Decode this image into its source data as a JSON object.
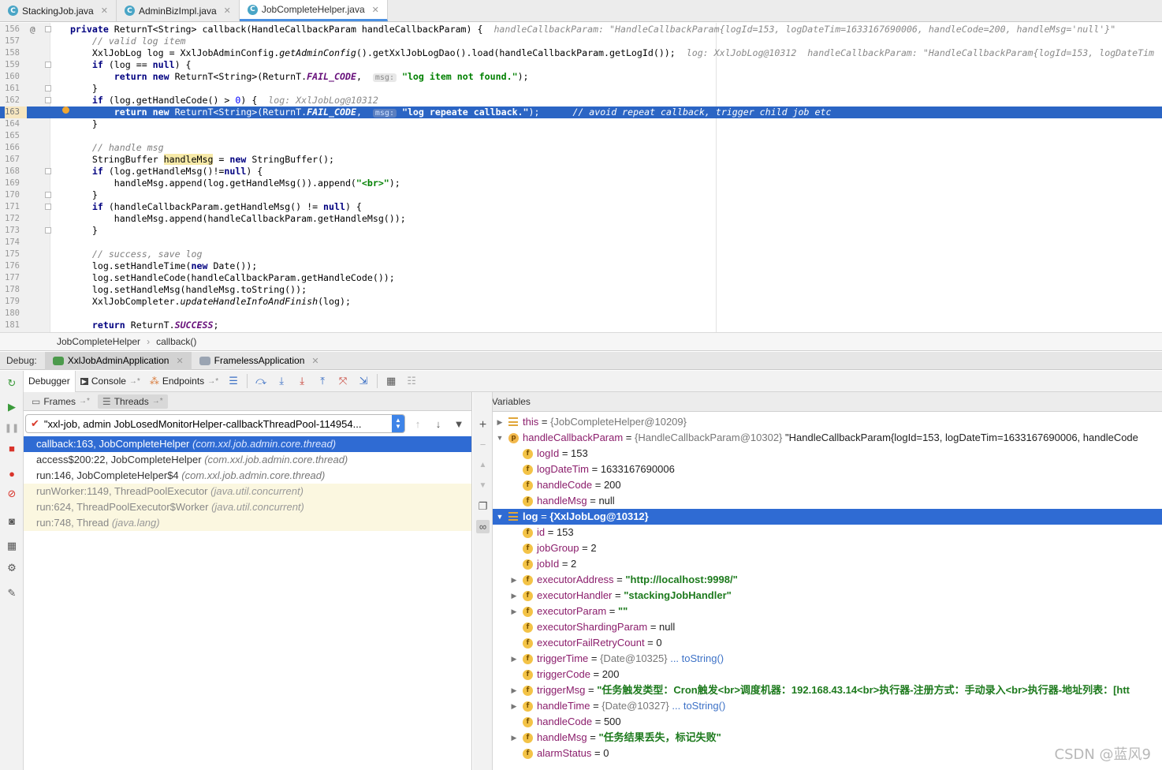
{
  "tabs": [
    {
      "label": "StackingJob.java",
      "active": false
    },
    {
      "label": "AdminBizImpl.java",
      "active": false
    },
    {
      "label": "JobCompleteHelper.java",
      "active": true
    }
  ],
  "editor": {
    "lines": [
      {
        "n": "156",
        "html": "<span class=\"kw\">private</span> ReturnT&lt;String&gt; callback(HandleCallbackParam handleCallbackParam) {  <span class=\"inl\">handleCallbackParam: \"HandleCallbackParam{logId=153, logDateTim=1633167690006, handleCode=200, handleMsg='null'}\"</span>"
      },
      {
        "n": "157",
        "html": "    <span class=\"cm\">// valid log item</span>"
      },
      {
        "n": "158",
        "html": "    XxlJobLog log = XxlJobAdminConfig.<span class=\"it\">getAdminConfig</span>().getXxlJobLogDao().load(handleCallbackParam.getLogId());  <span class=\"inl\">log: XxlJobLog@10312  handleCallbackParam: \"HandleCallbackParam{logId=153, logDateTim</span>"
      },
      {
        "n": "159",
        "html": "    <span class=\"kw\">if</span> (log == <span class=\"kw\">null</span>) {"
      },
      {
        "n": "160",
        "html": "        <span class=\"kw\">return new</span> ReturnT&lt;String&gt;(ReturnT.<span class=\"cst\">FAIL_CODE</span>,  <span class=\"hintbox\">msg:</span> <span class=\"st\">\"log item not found.\"</span>);"
      },
      {
        "n": "161",
        "html": "    }"
      },
      {
        "n": "162",
        "html": "    <span class=\"kw\">if</span> (log.getHandleCode() &gt; <span style=\"color:#0000ff\">0</span>) {  <span class=\"inl\">log: XxlJobLog@10312</span>"
      },
      {
        "n": "163",
        "html": "        <span class=\"kw\">return new</span> ReturnT&lt;String&gt;(ReturnT.<span class=\"cst\">FAIL_CODE</span>,  <span class=\"hintbox\">msg:</span> <span class=\"st\">\"log repeate callback.\"</span>);      <span class=\"cm\">// avoid repeat callback, trigger child job etc</span>"
      },
      {
        "n": "164",
        "html": "    }"
      },
      {
        "n": "165",
        "html": ""
      },
      {
        "n": "166",
        "html": "    <span class=\"cm\">// handle msg</span>"
      },
      {
        "n": "167",
        "html": "    StringBuffer <span class=\"var-hl\">handleMsg</span> = <span class=\"kw\">new</span> StringBuffer();"
      },
      {
        "n": "168",
        "html": "    <span class=\"kw\">if</span> (log.getHandleMsg()!=<span class=\"kw\">null</span>) {"
      },
      {
        "n": "169",
        "html": "        handleMsg.append(log.getHandleMsg()).append(<span class=\"st\">\"&lt;br&gt;\"</span>);"
      },
      {
        "n": "170",
        "html": "    }"
      },
      {
        "n": "171",
        "html": "    <span class=\"kw\">if</span> (handleCallbackParam.getHandleMsg() != <span class=\"kw\">null</span>) {"
      },
      {
        "n": "172",
        "html": "        handleMsg.append(handleCallbackParam.getHandleMsg());"
      },
      {
        "n": "173",
        "html": "    }"
      },
      {
        "n": "174",
        "html": ""
      },
      {
        "n": "175",
        "html": "    <span class=\"cm\">// success, save log</span>"
      },
      {
        "n": "176",
        "html": "    log.setHandleTime(<span class=\"kw\">new</span> Date());"
      },
      {
        "n": "177",
        "html": "    log.setHandleCode(handleCallbackParam.getHandleCode());"
      },
      {
        "n": "178",
        "html": "    log.setHandleMsg(handleMsg.toString());"
      },
      {
        "n": "179",
        "html": "    XxlJobCompleter.<span class=\"it\">updateHandleInfoAndFinish</span>(log);"
      },
      {
        "n": "180",
        "html": ""
      },
      {
        "n": "181",
        "html": "    <span class=\"kw\">return</span> ReturnT.<span class=\"cst\">SUCCESS</span>;"
      }
    ],
    "current_line": "163"
  },
  "breadcrumb": [
    "JobCompleteHelper",
    "callback()"
  ],
  "debug": {
    "label": "Debug:",
    "sessions": [
      {
        "label": "XxlJobAdminApplication",
        "active": true
      },
      {
        "label": "FramelessApplication",
        "active": false
      }
    ],
    "toolbar_tabs": [
      {
        "label": "Debugger",
        "active": true
      },
      {
        "label": "Console",
        "active": false
      },
      {
        "label": "Endpoints",
        "active": false
      }
    ]
  },
  "frames": {
    "tab_frames": "Frames",
    "tab_threads": "Threads",
    "thread": "\"xxl-job, admin JobLosedMonitorHelper-callbackThreadPool-114954...",
    "items": [
      {
        "method": "callback:163, JobCompleteHelper",
        "pkg": "(com.xxl.job.admin.core.thread)",
        "kind": "selected"
      },
      {
        "method": "access$200:22, JobCompleteHelper",
        "pkg": "(com.xxl.job.admin.core.thread)",
        "kind": "normal"
      },
      {
        "method": "run:146, JobCompleteHelper$4",
        "pkg": "(com.xxl.job.admin.core.thread)",
        "kind": "normal"
      },
      {
        "method": "runWorker:1149, ThreadPoolExecutor",
        "pkg": "(java.util.concurrent)",
        "kind": "lib"
      },
      {
        "method": "run:624, ThreadPoolExecutor$Worker",
        "pkg": "(java.util.concurrent)",
        "kind": "lib"
      },
      {
        "method": "run:748, Thread",
        "pkg": "(java.lang)",
        "kind": "lib"
      }
    ]
  },
  "variables": {
    "title": "Variables",
    "rows": [
      {
        "depth": 0,
        "expand": "closed",
        "icon": "list",
        "name": "this",
        "eq": " = ",
        "val": "{JobCompleteHelper@10209}",
        "vt": "ref"
      },
      {
        "depth": 0,
        "expand": "open",
        "icon": "p",
        "name": "handleCallbackParam",
        "eq": " = ",
        "val": "{HandleCallbackParam@10302} \"HandleCallbackParam{logId=153, logDateTim=1633167690006, handleCode",
        "vt": "mixed"
      },
      {
        "depth": 1,
        "expand": "none",
        "icon": "f",
        "name": "logId",
        "eq": " = ",
        "val": "153",
        "vt": "plain"
      },
      {
        "depth": 1,
        "expand": "none",
        "icon": "f",
        "name": "logDateTim",
        "eq": " = ",
        "val": "1633167690006",
        "vt": "plain"
      },
      {
        "depth": 1,
        "expand": "none",
        "icon": "f",
        "name": "handleCode",
        "eq": " = ",
        "val": "200",
        "vt": "plain"
      },
      {
        "depth": 1,
        "expand": "none",
        "icon": "f",
        "name": "handleMsg",
        "eq": " = ",
        "val": "null",
        "vt": "plain"
      },
      {
        "depth": 0,
        "expand": "open",
        "icon": "list",
        "name": "log",
        "eq": " = ",
        "val": "{XxlJobLog@10312}",
        "vt": "ref",
        "selected": true
      },
      {
        "depth": 1,
        "expand": "none",
        "icon": "f",
        "name": "id",
        "eq": " = ",
        "val": "153",
        "vt": "plain"
      },
      {
        "depth": 1,
        "expand": "none",
        "icon": "f",
        "name": "jobGroup",
        "eq": " = ",
        "val": "2",
        "vt": "plain"
      },
      {
        "depth": 1,
        "expand": "none",
        "icon": "f",
        "name": "jobId",
        "eq": " = ",
        "val": "2",
        "vt": "plain"
      },
      {
        "depth": 1,
        "expand": "closed",
        "icon": "f",
        "name": "executorAddress",
        "eq": " = ",
        "val": "\"http://localhost:9998/\"",
        "vt": "str"
      },
      {
        "depth": 1,
        "expand": "closed",
        "icon": "f",
        "name": "executorHandler",
        "eq": " = ",
        "val": "\"stackingJobHandler\"",
        "vt": "str"
      },
      {
        "depth": 1,
        "expand": "closed",
        "icon": "f",
        "name": "executorParam",
        "eq": " = ",
        "val": "\"\"",
        "vt": "str"
      },
      {
        "depth": 1,
        "expand": "none",
        "icon": "f",
        "name": "executorShardingParam",
        "eq": " = ",
        "val": "null",
        "vt": "plain"
      },
      {
        "depth": 1,
        "expand": "none",
        "icon": "f",
        "name": "executorFailRetryCount",
        "eq": " = ",
        "val": "0",
        "vt": "plain"
      },
      {
        "depth": 1,
        "expand": "closed",
        "icon": "f",
        "name": "triggerTime",
        "eq": " = ",
        "val": "{Date@10325}",
        "vt": "ref",
        "link": " ... toString()"
      },
      {
        "depth": 1,
        "expand": "none",
        "icon": "f",
        "name": "triggerCode",
        "eq": " = ",
        "val": "200",
        "vt": "plain"
      },
      {
        "depth": 1,
        "expand": "closed",
        "icon": "f",
        "name": "triggerMsg",
        "eq": " = ",
        "val": "\"任务触发类型：Cron触发<br>调度机器：192.168.43.14<br>执行器-注册方式：手动录入<br>执行器-地址列表：[htt",
        "vt": "str"
      },
      {
        "depth": 1,
        "expand": "closed",
        "icon": "f",
        "name": "handleTime",
        "eq": " = ",
        "val": "{Date@10327}",
        "vt": "ref",
        "link": " ... toString()"
      },
      {
        "depth": 1,
        "expand": "none",
        "icon": "f",
        "name": "handleCode",
        "eq": " = ",
        "val": "500",
        "vt": "plain"
      },
      {
        "depth": 1,
        "expand": "closed",
        "icon": "f",
        "name": "handleMsg",
        "eq": " = ",
        "val": "\"任务结果丢失，标记失败\"",
        "vt": "str"
      },
      {
        "depth": 1,
        "expand": "none",
        "icon": "f",
        "name": "alarmStatus",
        "eq": " = ",
        "val": "0",
        "vt": "plain"
      }
    ]
  },
  "watermark": "CSDN @蓝风9",
  "colors": {
    "selection": "#2f6bd3",
    "current_line": "#2b65c4",
    "string": "#1d7a1d",
    "field_name": "#8b1e6c"
  }
}
